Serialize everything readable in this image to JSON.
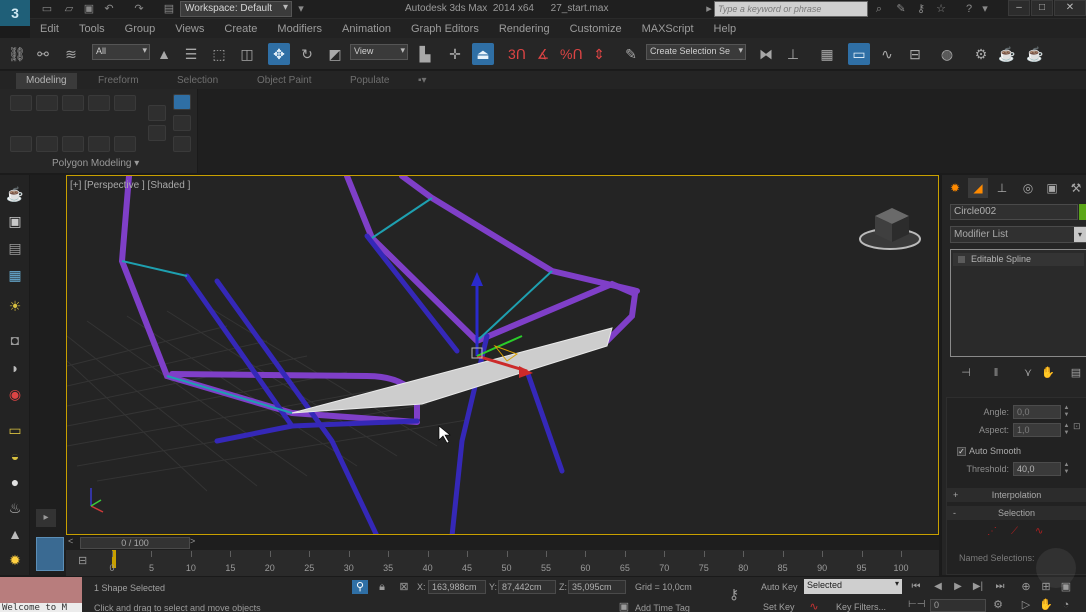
{
  "app": {
    "title": "Autodesk 3ds Max  2014 x64      27_start.max",
    "workspace": "Workspace: Default",
    "search_placeholder": "Type a keyword or phrase",
    "logo_icon": "3dsmax-logo-icon"
  },
  "menu": [
    "Edit",
    "Tools",
    "Group",
    "Views",
    "Create",
    "Modifiers",
    "Animation",
    "Graph Editors",
    "Rendering",
    "Customize",
    "MAXScript",
    "Help"
  ],
  "toolbar": {
    "filter": "All",
    "ref_coord": "View",
    "named_selection": "Create Selection Se",
    "snap_values": [
      "3",
      "%"
    ]
  },
  "ribbon": {
    "tabs": [
      "Modeling",
      "Freeform",
      "Selection",
      "Object Paint",
      "Populate"
    ],
    "active_tab": "Modeling",
    "panel_label": "Polygon Modeling ▾"
  },
  "viewport": {
    "label": "[+] [Perspective ] [Shaded ]",
    "accent": "#c8a000"
  },
  "command_panel": {
    "object_name": "Circle002",
    "object_color": "#5aa617",
    "modifier_list": "Modifier List",
    "stack_item": "Editable Spline",
    "params": {
      "angle_label": "Angle:",
      "angle_value": "0,0",
      "aspect_label": "Aspect:",
      "aspect_value": "1,0",
      "auto_smooth_label": "Auto Smooth",
      "auto_smooth_checked": true,
      "threshold_label": "Threshold:",
      "threshold_value": "40,0"
    },
    "rollouts": {
      "interpolation": "Interpolation",
      "selection": "Selection",
      "named_selections": "Named Selections:"
    }
  },
  "timeline": {
    "frame_display": "0 / 100",
    "ticks": [
      "0",
      "5",
      "10",
      "15",
      "20",
      "25",
      "30",
      "35",
      "40",
      "45",
      "50",
      "55",
      "60",
      "65",
      "70",
      "75",
      "80",
      "85",
      "90",
      "95",
      "100"
    ]
  },
  "status": {
    "welcome": "Welcome to M",
    "selection": "1 Shape Selected",
    "prompt": "Click and drag to select and move objects",
    "x_label": "X:",
    "x_value": "163,988cm",
    "y_label": "Y:",
    "y_value": "87,442cm",
    "z_label": "Z:",
    "z_value": "35,095cm",
    "grid": "Grid = 10,0cm",
    "add_time_tag": "Add Time Tag",
    "auto_key": "Auto Key",
    "set_key": "Set Key",
    "selected": "Selected",
    "key_filters": "Key Filters...",
    "current_frame": "0"
  }
}
